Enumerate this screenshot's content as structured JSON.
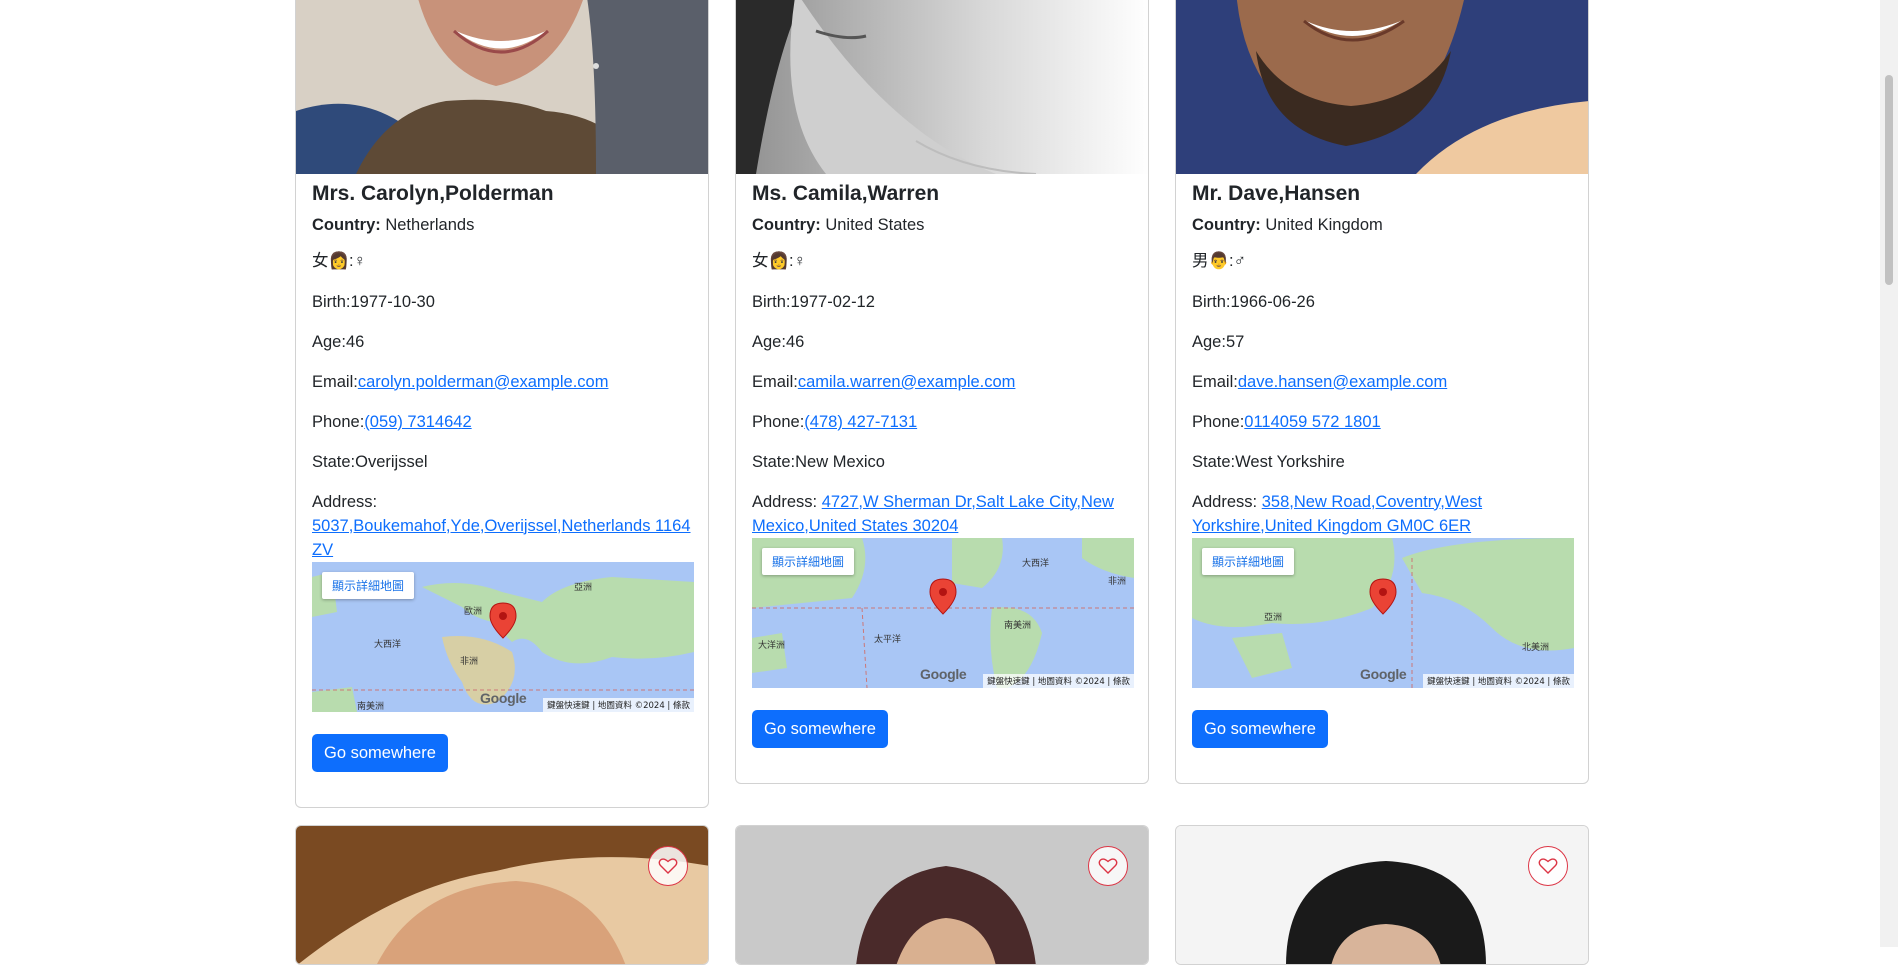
{
  "cards": [
    {
      "name": "Mrs. Carolyn,Polderman",
      "country_label": "Country:",
      "country": "Netherlands",
      "gender": "女👩:♀",
      "birth": "Birth:1977-10-30",
      "age": "Age:46",
      "email_label": "Email:",
      "email": "carolyn.polderman@example.com",
      "phone_label": "Phone:",
      "phone": "(059) 7314642",
      "state": "State:Overijssel",
      "address_label": "Address:",
      "address": "5037,Boukemahof,Yde,Overijssel,Netherlands 1164 ZV",
      "button": "Go somewhere"
    },
    {
      "name": "Ms. Camila,Warren",
      "country_label": "Country:",
      "country": "United States",
      "gender": "女👩:♀",
      "birth": "Birth:1977-02-12",
      "age": "Age:46",
      "email_label": "Email:",
      "email": "camila.warren@example.com",
      "phone_label": "Phone:",
      "phone": "(478) 427-7131",
      "state": "State:New Mexico",
      "address_label": "Address:",
      "address": "4727,W Sherman Dr,Salt Lake City,New Mexico,United States 30204",
      "button": "Go somewhere"
    },
    {
      "name": "Mr. Dave,Hansen",
      "country_label": "Country:",
      "country": "United Kingdom",
      "gender": "男👨:♂",
      "birth": "Birth:1966-06-26",
      "age": "Age:57",
      "email_label": "Email:",
      "email": "dave.hansen@example.com",
      "phone_label": "Phone:",
      "phone": "0114059 572 1801",
      "state": "State:West Yorkshire",
      "address_label": "Address:",
      "address": "358,New Road,Coventry,West Yorkshire,United Kingdom GM0C 6ER",
      "button": "Go somewhere"
    }
  ],
  "map": {
    "detail_button": "顯示詳細地圖",
    "footer": "鍵盤快速鍵 | 地圖資料 ©2024 | 條款",
    "logo": "Google",
    "labels_1": [
      "亞洲",
      "歐洲",
      "大西洋",
      "非洲",
      "南美洲"
    ],
    "labels_2": [
      "大西洋",
      "大洋洲",
      "太平洋",
      "南美洲",
      "非洲"
    ],
    "labels_3": [
      "亞洲",
      "北美洲"
    ]
  },
  "colors": {
    "primary": "#0d6efd",
    "heart": "#dc3545",
    "ocean": "#a9c6f5",
    "land": "#b8dcae"
  },
  "icons": {
    "favorite": "heart-outline-icon",
    "marker": "map-pin-icon"
  }
}
